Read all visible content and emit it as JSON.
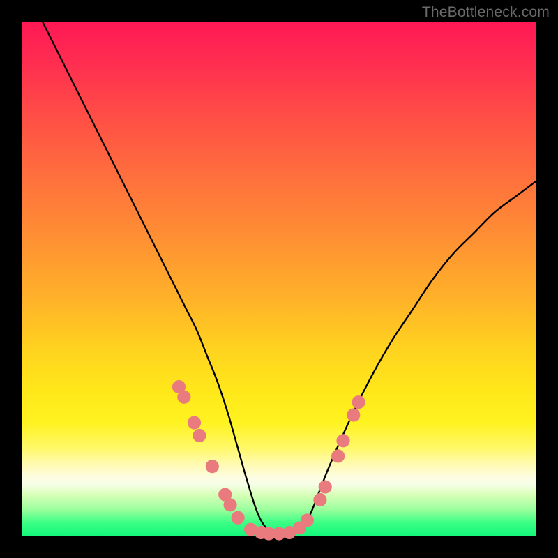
{
  "watermark": "TheBottleneck.com",
  "chart_data": {
    "type": "line",
    "title": "",
    "xlabel": "",
    "ylabel": "",
    "xlim": [
      0,
      100
    ],
    "ylim": [
      0,
      100
    ],
    "series": [
      {
        "name": "curve",
        "color": "#000000",
        "x": [
          4,
          8,
          12,
          16,
          20,
          24,
          28,
          30,
          32,
          34,
          36,
          38,
          40,
          42,
          44,
          46,
          48,
          50,
          52,
          54,
          56,
          58,
          60,
          64,
          68,
          72,
          76,
          80,
          84,
          88,
          92,
          96,
          100
        ],
        "y": [
          100,
          92,
          84,
          76,
          68,
          60,
          52,
          48,
          44,
          40,
          35,
          30,
          24,
          17,
          10,
          4,
          1,
          0,
          0,
          1,
          4,
          9,
          14,
          23,
          31,
          38,
          44,
          50,
          55,
          59,
          63,
          66,
          69
        ]
      }
    ],
    "markers": {
      "name": "dots",
      "color": "#e97a7d",
      "radius_pct": 1.3,
      "points": [
        {
          "x": 30.5,
          "y": 29
        },
        {
          "x": 31.5,
          "y": 27
        },
        {
          "x": 33.5,
          "y": 22
        },
        {
          "x": 34.5,
          "y": 19.5
        },
        {
          "x": 37.0,
          "y": 13.5
        },
        {
          "x": 39.5,
          "y": 8
        },
        {
          "x": 40.5,
          "y": 6
        },
        {
          "x": 42.0,
          "y": 3.5
        },
        {
          "x": 44.5,
          "y": 1.2
        },
        {
          "x": 46.5,
          "y": 0.6
        },
        {
          "x": 48.0,
          "y": 0.4
        },
        {
          "x": 50.0,
          "y": 0.4
        },
        {
          "x": 52.0,
          "y": 0.6
        },
        {
          "x": 54.0,
          "y": 1.5
        },
        {
          "x": 55.5,
          "y": 3.0
        },
        {
          "x": 58.0,
          "y": 7.0
        },
        {
          "x": 59.0,
          "y": 9.5
        },
        {
          "x": 61.5,
          "y": 15.5
        },
        {
          "x": 62.5,
          "y": 18.5
        },
        {
          "x": 64.5,
          "y": 23.5
        },
        {
          "x": 65.5,
          "y": 26.0
        }
      ]
    }
  }
}
